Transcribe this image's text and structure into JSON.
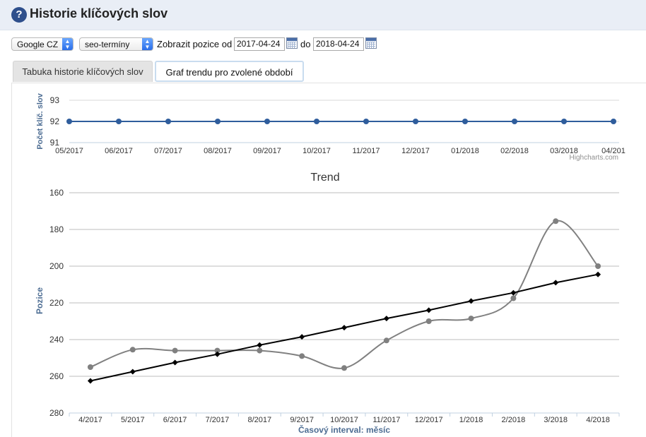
{
  "header": {
    "title": "Historie klíčových slov",
    "help_icon": "question-circle-icon"
  },
  "filters": {
    "engine_select": "Google CZ",
    "group_select": "seo-termíny",
    "from_label": "Zobrazit pozice od",
    "date_from": "2017-04-24",
    "to_label": "do",
    "date_to": "2018-04-24"
  },
  "tabs": [
    {
      "label": "Tabuka historie klíčových slov",
      "active": false
    },
    {
      "label": "Graf trendu pro zvolené období",
      "active": true
    }
  ],
  "chart_data": [
    {
      "type": "line",
      "title": "",
      "ylabel": "Počet klíč. slov",
      "xlabel": "",
      "categories": [
        "05/2017",
        "06/2017",
        "07/2017",
        "08/2017",
        "09/2017",
        "10/2017",
        "11/2017",
        "12/2017",
        "01/2018",
        "02/2018",
        "03/2018",
        "04/201"
      ],
      "yticks": [
        91,
        92,
        93
      ],
      "ylim": [
        91,
        93
      ],
      "series": [
        {
          "values": [
            92,
            92,
            92,
            92,
            92,
            92,
            92,
            92,
            92,
            92,
            92,
            92
          ],
          "color": "#2f5d9c"
        }
      ],
      "credit": "Highcharts.com",
      "grid": true
    },
    {
      "type": "line",
      "title": "Trend",
      "ylabel": "Pozice",
      "xlabel": "Časový interval: měsíc",
      "categories": [
        "4/2017",
        "5/2017",
        "6/2017",
        "7/2017",
        "8/2017",
        "9/2017",
        "10/2017",
        "11/2017",
        "12/2017",
        "1/2018",
        "2/2018",
        "3/2018",
        "4/2018"
      ],
      "yticks": [
        160,
        180,
        200,
        220,
        240,
        260,
        280
      ],
      "ylim": [
        160,
        280
      ],
      "reversed_y": true,
      "series": [
        {
          "values": [
            255,
            245.5,
            246,
            246,
            246,
            249,
            255.5,
            240.5,
            230,
            228.5,
            217.5,
            175.5,
            200
          ],
          "color": "#808080",
          "smooth": true,
          "marker": "circle"
        },
        {
          "values": [
            262.5,
            257.5,
            252.5,
            248,
            243,
            238.5,
            233.5,
            228.5,
            224,
            219,
            214.5,
            209,
            204.5
          ],
          "color": "#000000",
          "smooth": false,
          "marker": "diamond"
        }
      ],
      "grid": true
    }
  ]
}
